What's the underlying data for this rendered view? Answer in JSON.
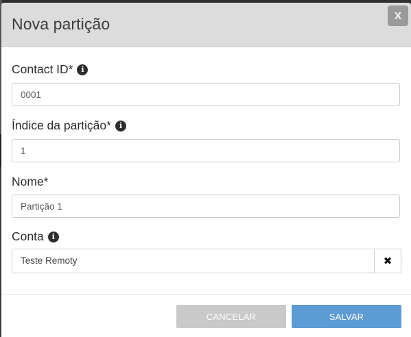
{
  "modal": {
    "title": "Nova partição",
    "close_label": "X"
  },
  "fields": {
    "contact_id": {
      "label": "Contact ID*",
      "value": "0001"
    },
    "partition_index": {
      "label": "Índice da partição*",
      "value": "1"
    },
    "name": {
      "label": "Nome*",
      "value": "Partição 1"
    },
    "account": {
      "label": "Conta",
      "value": "Teste Remoty",
      "clear_label": "✖"
    }
  },
  "footer": {
    "cancel_label": "CANCELAR",
    "save_label": "SALVAR"
  },
  "colors": {
    "header_bg": "#dcdcdc",
    "save_button": "#5d9bd5",
    "cancel_button": "#c9c9c9",
    "close_button": "#9a9a9a"
  },
  "icons": [
    "info-icon",
    "close-icon",
    "clear-icon"
  ]
}
